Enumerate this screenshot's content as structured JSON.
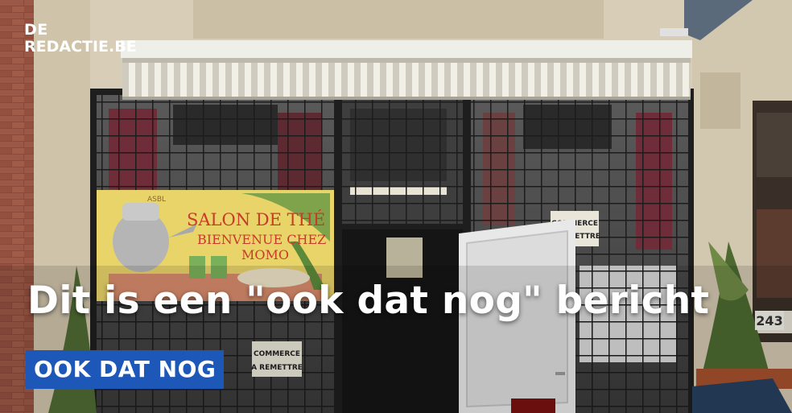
{
  "brand": {
    "line1": "DE",
    "line2": "REDACTIE.BE"
  },
  "sign": {
    "line1": "SALON DE THÉ",
    "line2": "BIENVENUE CHEZ",
    "line3": "MOMO",
    "corner": "ASBL"
  },
  "notice": {
    "line1": "COMMERCE",
    "line2": "A REMETTRE"
  },
  "house_number": "243",
  "headline": "Dit is een \"ook dat nog\" bericht",
  "category_tag": "OOK DAT NOG"
}
